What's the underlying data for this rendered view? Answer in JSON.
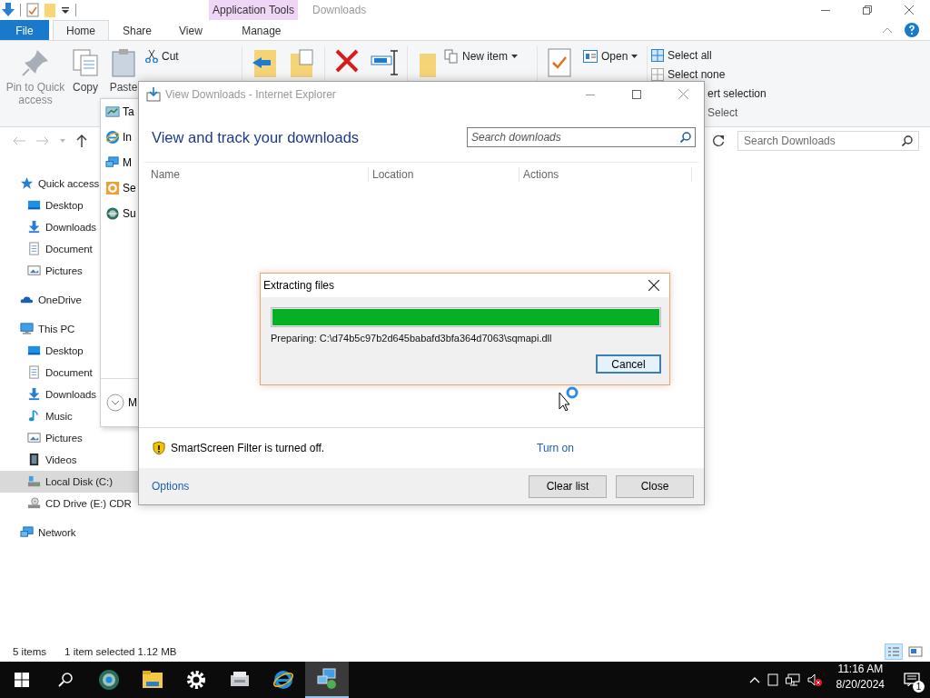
{
  "explorer": {
    "context_group": "Application Tools",
    "title": "Downloads",
    "tabs": [
      {
        "label": "File",
        "kind": "file",
        "selected": false
      },
      {
        "label": "Home",
        "kind": "tab",
        "selected": true
      },
      {
        "label": "Share",
        "kind": "tab",
        "selected": false
      },
      {
        "label": "View",
        "kind": "tab",
        "selected": false
      },
      {
        "label": "Manage",
        "kind": "context",
        "selected": false
      }
    ],
    "ribbon": {
      "pin": "Pin to Quick access",
      "copy": "Copy",
      "paste": "Paste",
      "cut": "Cut",
      "new_item": "New item",
      "open": "Open",
      "select_all": "Select all",
      "select_none": "Select none",
      "invert_selection": "ert selection",
      "select_group": "Select"
    },
    "search_placeholder": "Search Downloads",
    "nav": [
      {
        "label": "Quick access",
        "kind": "star",
        "selected": false,
        "children": [
          {
            "label": "Desktop",
            "kind": "desktop",
            "selected": false
          },
          {
            "label": "Downloads",
            "kind": "download",
            "selected": false
          },
          {
            "label": "Document",
            "kind": "document",
            "selected": false
          },
          {
            "label": "Pictures",
            "kind": "picture",
            "selected": false
          }
        ]
      },
      {
        "label": "OneDrive",
        "kind": "cloud",
        "selected": false
      },
      {
        "label": "This PC",
        "kind": "pc",
        "selected": false,
        "children": [
          {
            "label": "Desktop",
            "kind": "desktop",
            "selected": false
          },
          {
            "label": "Document",
            "kind": "document",
            "selected": false
          },
          {
            "label": "Downloads",
            "kind": "download",
            "selected": false
          },
          {
            "label": "Music",
            "kind": "music",
            "selected": false
          },
          {
            "label": "Pictures",
            "kind": "picture",
            "selected": false
          },
          {
            "label": "Videos",
            "kind": "video",
            "selected": false
          },
          {
            "label": "Local Disk (C:)",
            "kind": "disk",
            "selected": true
          },
          {
            "label": "CD Drive (E:) CDR",
            "kind": "cd",
            "selected": false
          }
        ]
      },
      {
        "label": "Network",
        "kind": "network",
        "selected": false
      }
    ],
    "status": {
      "items": "5 items",
      "selection": "1 item selected  1.12 MB"
    }
  },
  "popup_menu": {
    "items": [
      {
        "label": "Ta",
        "kind": "control-panel"
      },
      {
        "label": "In",
        "kind": "browser"
      },
      {
        "label": "M",
        "kind": "network"
      },
      {
        "label": "Se",
        "kind": "gear"
      },
      {
        "label": "Su",
        "kind": "globe"
      }
    ],
    "footer": "M"
  },
  "ie_window": {
    "title": "View Downloads - Internet Explorer",
    "heading": "View and track your downloads",
    "search_placeholder": "Search downloads",
    "columns": [
      "Name",
      "Location",
      "Actions"
    ],
    "smartscreen": "SmartScreen Filter is turned off.",
    "turn_on": "Turn on",
    "options": "Options",
    "buttons": [
      "Clear list",
      "Close"
    ]
  },
  "extract_dialog": {
    "title": "Extracting files",
    "level": 1,
    "status": "Preparing: C:\\d74b5c97b2d645babafd3bfa364d7063\\sqmapi.dll",
    "button": "Cancel"
  },
  "taskbar": {
    "apps": [
      {
        "kind": "globe",
        "selected": false
      },
      {
        "kind": "folder",
        "selected": false
      },
      {
        "kind": "gear",
        "selected": false
      },
      {
        "kind": "device",
        "selected": false
      },
      {
        "kind": "browser",
        "selected": false
      },
      {
        "kind": "network",
        "selected": true
      }
    ],
    "time": "11:16 AM",
    "date": "8/20/2024",
    "notifications": "1"
  }
}
